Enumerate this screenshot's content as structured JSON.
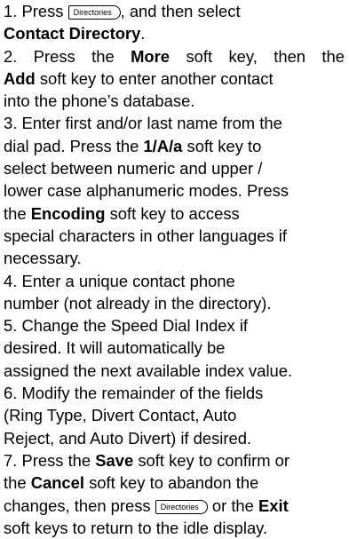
{
  "hardkey_label": "Directories",
  "steps": [
    {
      "s1_a": "1. Press ",
      "s1_b": ", and then select",
      "s1_c": "Contact Directory",
      "s1_d": "."
    },
    {
      "s2_a": "2. Press the ",
      "s2_b": "More",
      "s2_c": " soft key, then the",
      "s2_d": "Add",
      "s2_e": " soft key to enter another contact",
      "s2_f": "into the phone’s database."
    },
    {
      "s3_a": "3. Enter first and/or last name from the",
      "s3_b": "dial pad. Press the ",
      "s3_c": "1/A/a",
      "s3_d": " soft key to",
      "s3_e": "select between numeric and upper /",
      "s3_f": "lower case alphanumeric modes. Press",
      "s3_g": "the ",
      "s3_h": "Encoding",
      "s3_i": " soft key to access",
      "s3_j": "special characters in other languages if",
      "s3_k": "necessary."
    },
    {
      "s4_a": "4. Enter a unique contact phone",
      "s4_b": "number (not already in the directory)."
    },
    {
      "s5_a": "5. Change the Speed Dial Index if",
      "s5_b": "desired. It will automatically be",
      "s5_c": "assigned the next available index value."
    },
    {
      "s6_a": "6. Modify the remainder of the fields",
      "s6_b": "(Ring Type, Divert Contact, Auto",
      "s6_c": "Reject, and Auto Divert) if desired."
    },
    {
      "s7_a": "7. Press the ",
      "s7_b": "Save",
      "s7_c": " soft key to confirm or",
      "s7_d": "the ",
      "s7_e": "Cancel",
      "s7_f": " soft key to abandon the",
      "s7_g": "changes, then press ",
      "s7_h": " or the ",
      "s7_i": "Exit",
      "s7_j": "soft keys to return to the idle display."
    }
  ]
}
